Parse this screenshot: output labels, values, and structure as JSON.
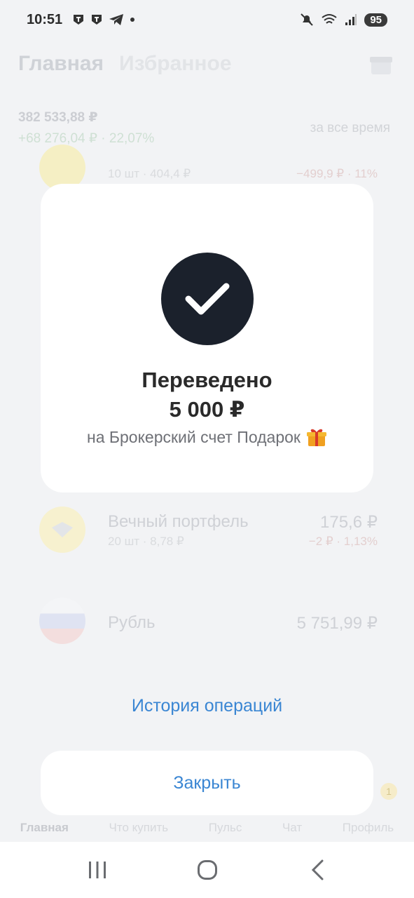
{
  "status_bar": {
    "time": "10:51",
    "battery": "95"
  },
  "background": {
    "tabs": [
      "Главная",
      "Избранное"
    ],
    "balance": "382 533,88 ₽",
    "balance_change": "+68 276,04 ₽ · 22,07%",
    "period": "за все время",
    "assets": [
      {
        "name": "",
        "sub": "10 шт · 404,4 ₽",
        "value": "",
        "change": "−499,9 ₽ · 11%"
      },
      {
        "name": "Вечный портфель",
        "sub": "20 шт · 8,78 ₽",
        "value": "175,6 ₽",
        "change": "−2 ₽ · 1,13%"
      },
      {
        "name": "Рубль",
        "sub": "",
        "value": "5 751,99 ₽",
        "change": ""
      }
    ],
    "nav": [
      "Главная",
      "Что купить",
      "Пульс",
      "Чат",
      "Профиль"
    ],
    "nav_badge": "1"
  },
  "modal": {
    "title": "Переведено",
    "amount": "5 000 ₽",
    "destination": "на Брокерский счет Подарок",
    "destination_icon": "gift-icon"
  },
  "actions": {
    "history": "История операций",
    "close": "Закрыть"
  },
  "colors": {
    "accent": "#3a86d3",
    "check_bg": "#1b212c"
  }
}
